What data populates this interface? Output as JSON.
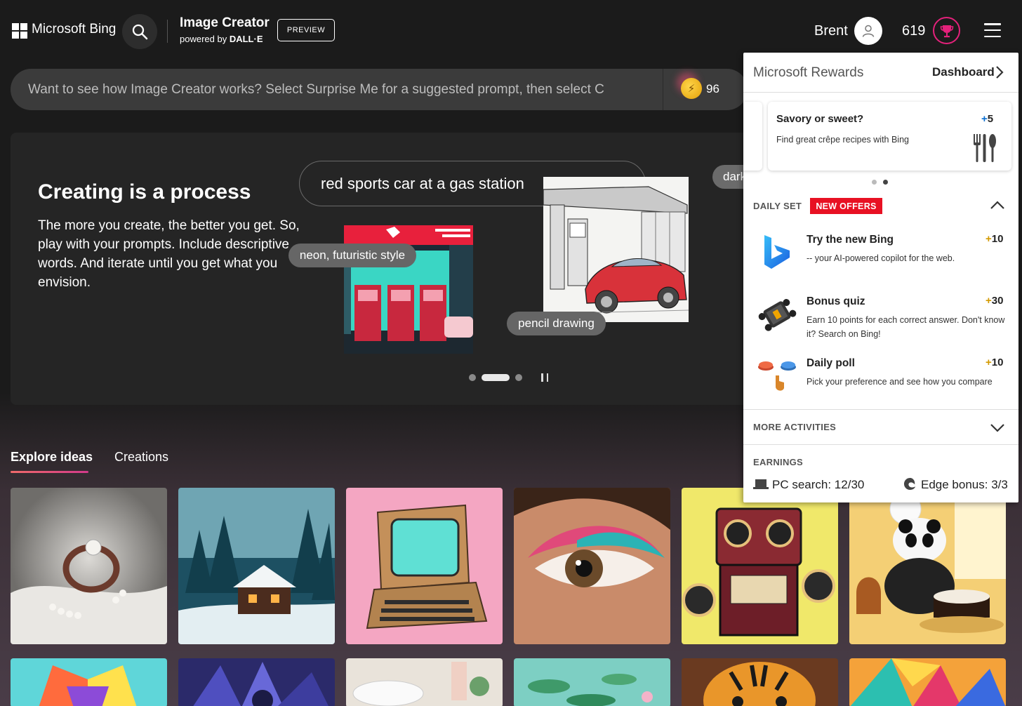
{
  "header": {
    "brand": "Microsoft Bing",
    "product_title": "Image Creator",
    "product_sub_prefix": "powered by ",
    "product_sub_brand": "DALL·E",
    "preview_label": "PREVIEW",
    "user_name": "Brent",
    "points": "619"
  },
  "prompt": {
    "placeholder": "Want to see how Image Creator works? Select Surprise Me for a suggested prompt, then select C",
    "boosts": "96"
  },
  "hero": {
    "title": "Creating is a process",
    "text": "The more you create, the better you get. So, play with your prompts. Include descriptive words. And iterate until you get what you envision.",
    "prompt_chip": "red sports car at a gas station",
    "partial_chip": "dark",
    "chip_neon": "neon, futuristic style",
    "chip_pencil": "pencil drawing"
  },
  "tabs": {
    "explore": "Explore ideas",
    "creations": "Creations"
  },
  "rewards": {
    "title": "Microsoft Rewards",
    "dashboard": "Dashboard",
    "offer": {
      "title": "Savory or sweet?",
      "desc": "Find great crêpe recipes with Bing",
      "plus": "+",
      "points": "5"
    },
    "daily_set_label": "DAILY SET",
    "new_offers": "NEW OFFERS",
    "activities": [
      {
        "title": "Try the new Bing",
        "desc": "-- your AI-powered copilot for the web.",
        "plus": "+",
        "points": "10"
      },
      {
        "title": "Bonus quiz",
        "desc": "Earn 10 points for each correct answer. Don't know it? Search on Bing!",
        "plus": "+",
        "points": "30"
      },
      {
        "title": "Daily poll",
        "desc": "Pick your preference and see how you compare",
        "plus": "+",
        "points": "10"
      }
    ],
    "more_activities": "MORE ACTIVITIES",
    "earnings_label": "EARNINGS",
    "pc_search": "PC search: 12/30",
    "edge_bonus": "Edge bonus: 3/3"
  },
  "colors": {
    "accent_pink": "#e4217b",
    "new_offers_red": "#e81123",
    "tab_underline": "#e85a7a"
  },
  "icons": [
    "microsoft-logo-icon",
    "search-icon",
    "user-icon",
    "trophy-icon",
    "hamburger-menu-icon",
    "boost-icon",
    "chevron-right-icon",
    "cutlery-icon",
    "chevron-up-icon",
    "bing-logo-icon",
    "quiz-icon",
    "poll-icon",
    "chevron-down-icon",
    "laptop-icon",
    "edge-icon",
    "pause-icon"
  ]
}
